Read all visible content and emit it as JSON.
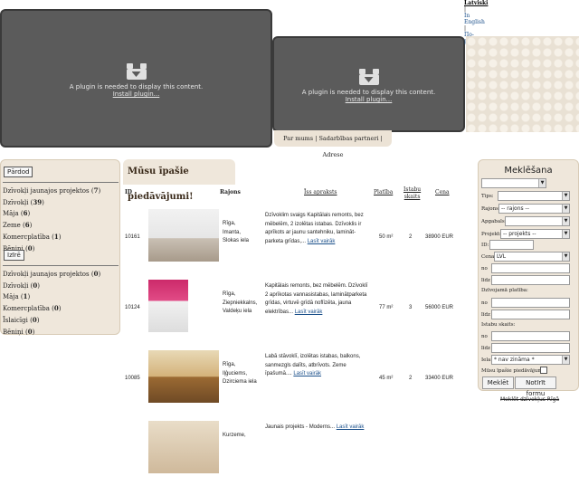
{
  "plugin": {
    "message": "A plugin is needed to display this content.",
    "install": "Install plugin..."
  },
  "languages": {
    "latvian": "Latviski",
    "english": "In English",
    "russian": "По-русски",
    "sep": "|"
  },
  "nav": {
    "text": "Par mums | Sadarbības partneri | Adrese"
  },
  "left": {
    "tab_sell": "Pārdod",
    "sell_items": [
      {
        "label": "Dzīvokļi jaunajos projektos",
        "count": "7"
      },
      {
        "label": "Dzīvokļi",
        "count": "39"
      },
      {
        "label": "Māja",
        "count": "6"
      },
      {
        "label": "Zeme",
        "count": "6"
      },
      {
        "label": "Komercplatība",
        "count": "1"
      },
      {
        "label": "Bēniņi",
        "count": "0"
      }
    ],
    "tab_rent": "Izīrē",
    "rent_items": [
      {
        "label": "Dzīvokļi jaunajos projektos",
        "count": "0"
      },
      {
        "label": "Dzīvokļi",
        "count": "0"
      },
      {
        "label": "Māja",
        "count": "1"
      },
      {
        "label": "Komercplatība",
        "count": "0"
      },
      {
        "label": "Īslaicīgi",
        "count": "0"
      },
      {
        "label": "Bēniņi",
        "count": "0"
      }
    ]
  },
  "content": {
    "title": "Mūsu īpašie piedāvājumi!",
    "headers": {
      "id": "ID",
      "district": "Rajons",
      "desc": "Īss apraksts",
      "area": "Platība",
      "rooms_line1": "Istabu",
      "rooms_line2": "skaits",
      "price": "Cena"
    },
    "more_label": "Lasīt vairāk",
    "rows": [
      {
        "id": "10161",
        "district": [
          "Rīga,",
          "Imanta,",
          "Slokas iela"
        ],
        "desc": "Dzīvoklim svaigs Kapitālais remonts, bez mēbelēm, 2 izolētas istabas. Dzīvoklis ir aprīkots ar jaunu santehniku, lamināt­parketa grīdas,...",
        "area": "50 m²",
        "rooms": "2",
        "price": "38900 EUR"
      },
      {
        "id": "10124",
        "district": [
          "Rīga,",
          "Ziepniekkalns,",
          "Valdeķu iela"
        ],
        "desc": "Kapitālais remonts, bez mēbelēm. Dzīvoklī 2 aprīkotas vannasistabas, lamināt­parketa grīdas, virtuvē grīdā noflīzēta, jauna elektrības...",
        "area": "77 m²",
        "rooms": "3",
        "price": "56000 EUR"
      },
      {
        "id": "10085",
        "district": [
          "Rīga,",
          "Iļģuciems,",
          "Dzirciema iela"
        ],
        "desc": "Labā stāvoklī, izolētas istabas, balkons, sanmezgls dalīts, atbrīvots. Zeme īpašumā....",
        "area": "45 m²",
        "rooms": "2",
        "price": "33400 EUR"
      },
      {
        "id": "",
        "district": [
          "Kurzeme,"
        ],
        "desc": "Jaunais projekts - Moderns...",
        "area": "",
        "rooms": "",
        "price": ""
      }
    ]
  },
  "search": {
    "title": "Meklēšana",
    "type_label": "Tips:",
    "district_label": "Rajons:",
    "district_value": "-- rajons --",
    "subdistrict_label": "Apgabals:",
    "project_label": "Projekts:",
    "project_value": "-- projekts --",
    "id_label": "ID:",
    "price_label": "Cena",
    "currency_value": "LVL",
    "from_label": "no",
    "to_label": "līdz",
    "area_label": "Dzīvojamā platība:",
    "rooms_label": "Istabu skaits:",
    "street_label": "Iela:",
    "street_value": "* nav zināma *",
    "special_label": "Mūsu īpašie piedāvājumi:",
    "search_button": "Meklēt",
    "clear_button": "Notīrīt formu"
  },
  "footer": {
    "link": "Meklēt dzīvokļus Rīgā"
  }
}
